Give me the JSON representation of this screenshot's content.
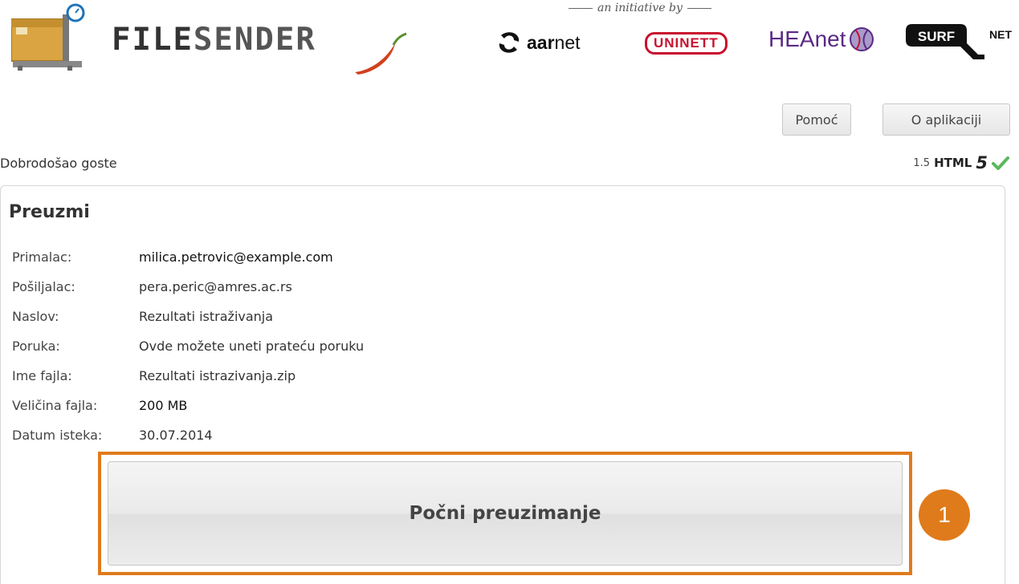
{
  "header": {
    "logo_part1": "FILE",
    "logo_part2": "SENDER",
    "initiative": "an initiative by",
    "partners": {
      "aarnet_bold": "aar",
      "aarnet_rest": "net",
      "uninett": "UNINETT",
      "heanet": "HEAnet",
      "surf": "SURF",
      "surf_net": "NET"
    }
  },
  "toolbar": {
    "help_label": "Pomoć",
    "about_label": "O aplikaciji"
  },
  "status": {
    "welcome": "Dobrodošao goste",
    "version": "1.5",
    "html_label": "HTML",
    "html_five": "5"
  },
  "panel": {
    "title": "Preuzmi",
    "rows": [
      {
        "label": "Primalac:",
        "value": "milica.petrovic@example.com"
      },
      {
        "label": "Pošiljalac:",
        "value": "pera.peric@amres.ac.rs"
      },
      {
        "label": "Naslov:",
        "value": "Rezultati istraživanja"
      },
      {
        "label": "Poruka:",
        "value": "Ovde možete uneti prateću poruku"
      },
      {
        "label": "Ime fajla:",
        "value": "Rezultati istrazivanja.zip"
      },
      {
        "label": "Veličina fajla:",
        "value": "200 MB"
      },
      {
        "label": "Datum isteka:",
        "value": "30.07.2014"
      }
    ],
    "download_label": "Počni preuzimanje",
    "step_number": "1"
  },
  "colors": {
    "accent": "#e07b1c",
    "check": "#5cb85c",
    "uninett": "#c8102e",
    "heanet": "#5b2a86"
  }
}
